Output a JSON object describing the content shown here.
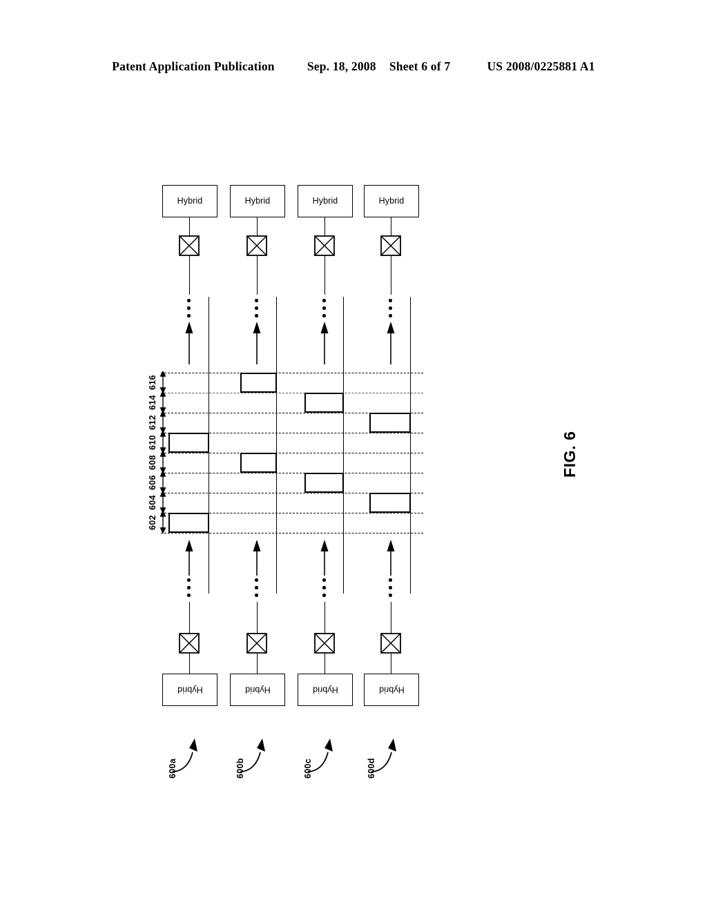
{
  "header": {
    "publication": "Patent Application Publication",
    "date": "Sep. 18, 2008",
    "sheet": "Sheet 6 of 7",
    "pub_number": "US 2008/0225881 A1"
  },
  "figure": {
    "caption": "FIG. 6",
    "block_label": "Hybrid",
    "top_blocks": [
      {
        "label": "Hybrid"
      },
      {
        "label": "Hybrid"
      },
      {
        "label": "Hybrid"
      },
      {
        "label": "Hybrid"
      }
    ],
    "bottom_blocks": [
      {
        "label": "Hybrid"
      },
      {
        "label": "Hybrid"
      },
      {
        "label": "Hybrid"
      },
      {
        "label": "Hybrid"
      }
    ],
    "column_refs": [
      "600a",
      "600b",
      "600c",
      "600d"
    ],
    "band_refs": [
      "602",
      "604",
      "606",
      "608",
      "610",
      "612",
      "614",
      "616"
    ]
  },
  "chart_data": {
    "type": "table",
    "title": "FIG. 6",
    "description": "Four parallel transport channels (600a-600d). Each channel shows two occupied time/frequency slots within eight stacked bands labeled 602 through 616 (bottom to top).",
    "ylabel": "",
    "xlabel": "",
    "categories": [
      "600a",
      "600b",
      "600c",
      "600d"
    ],
    "bands": [
      "602",
      "604",
      "606",
      "608",
      "610",
      "612",
      "614",
      "616"
    ],
    "legend_position": "none",
    "grid": true,
    "series": [
      {
        "name": "600a",
        "occupied_bands": [
          "602",
          "610"
        ]
      },
      {
        "name": "600b",
        "occupied_bands": [
          "608",
          "616"
        ]
      },
      {
        "name": "600c",
        "occupied_bands": [
          "606",
          "614"
        ]
      },
      {
        "name": "600d",
        "occupied_bands": [
          "604",
          "612"
        ]
      }
    ]
  }
}
